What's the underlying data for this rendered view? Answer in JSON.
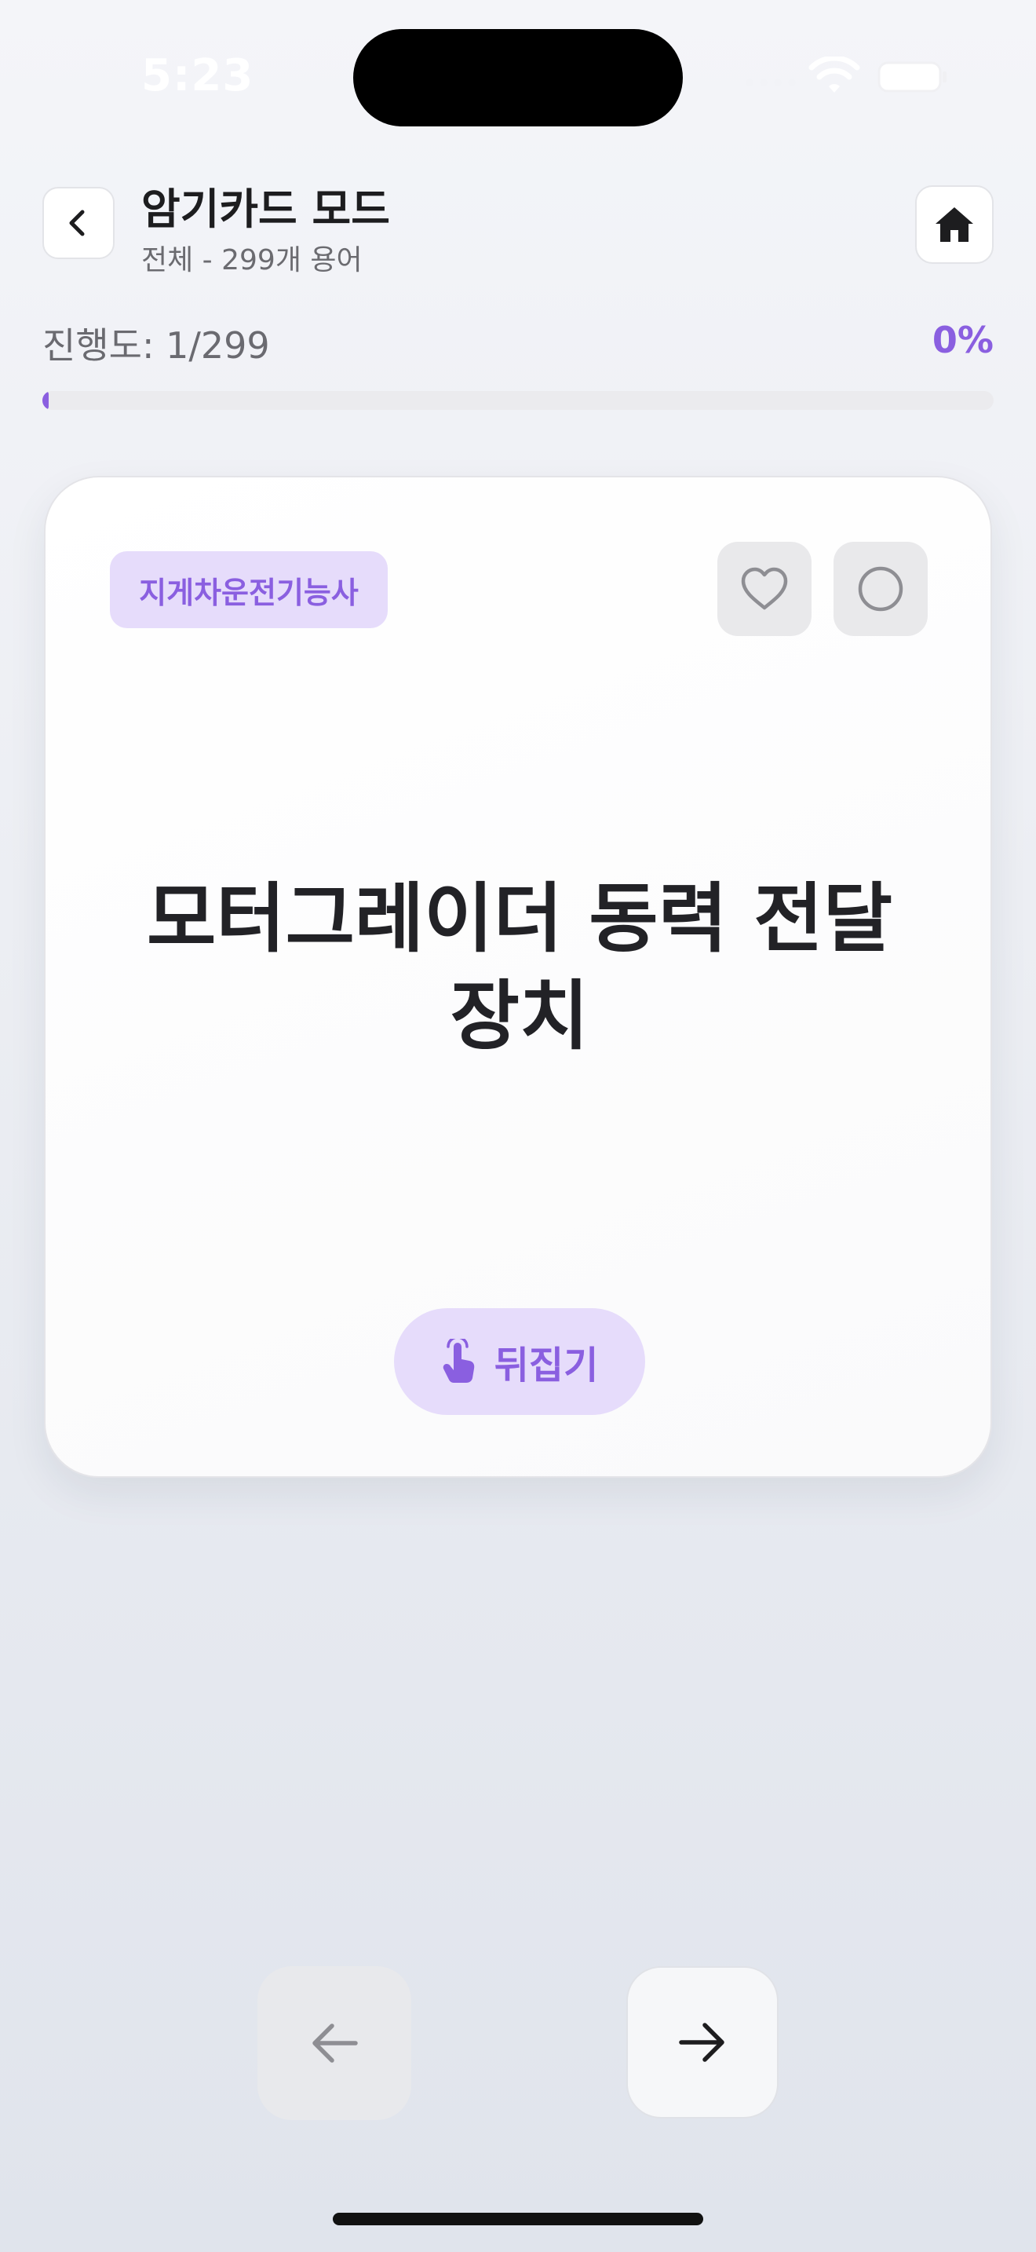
{
  "status_bar": {
    "time": "5:23"
  },
  "header": {
    "title": "암기카드 모드",
    "subtitle": "전체 - 299개 용어",
    "back_icon": "chevron-left-icon",
    "home_icon": "home-icon"
  },
  "progress": {
    "label": "진행도: 1/299",
    "percent_label": "0%",
    "fraction": 0.0033
  },
  "card": {
    "category": "지게차운전기능사",
    "term": "모터그레이더 동력 전달 장치",
    "flip_label": "뒤집기",
    "flip_icon": "tap-hand-icon",
    "favorite_icon": "heart-icon",
    "known_icon": "circle-icon"
  },
  "navigation": {
    "prev_icon": "arrow-left-icon",
    "next_icon": "arrow-right-icon"
  },
  "colors": {
    "accent": "#8a5fe0",
    "badge_bg": "#e6dcfb"
  }
}
